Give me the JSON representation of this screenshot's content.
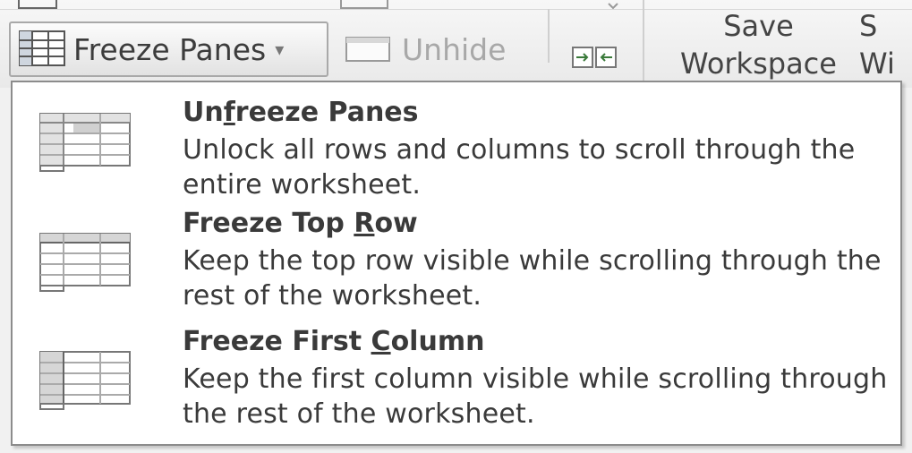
{
  "ribbon": {
    "freeze_panes": {
      "label": "Freeze Panes",
      "caret": "▾",
      "icon": "freeze-panes-icon"
    },
    "unhide": {
      "label": "Unhide",
      "icon": "unhide-window-icon"
    },
    "side_by_side": {
      "icon": "view-side-by-side-icon"
    },
    "save_workspace": {
      "line1": "Save",
      "line2": "Workspace"
    },
    "switch_windows": {
      "line1": "S",
      "line2": "Wi"
    }
  },
  "menu": {
    "items": [
      {
        "title_before": "Un",
        "title_key": "f",
        "title_after": "reeze Panes",
        "description": "Unlock all rows and columns to scroll through the entire worksheet.",
        "icon": "unfreeze-panes-icon"
      },
      {
        "title_before": "Freeze Top ",
        "title_key": "R",
        "title_after": "ow",
        "description": "Keep the top row visible while scrolling through the rest of the worksheet.",
        "icon": "freeze-top-row-icon"
      },
      {
        "title_before": "Freeze First ",
        "title_key": "C",
        "title_after": "olumn",
        "description": "Keep the first column visible while scrolling through the rest of the worksheet.",
        "icon": "freeze-first-column-icon"
      }
    ]
  }
}
